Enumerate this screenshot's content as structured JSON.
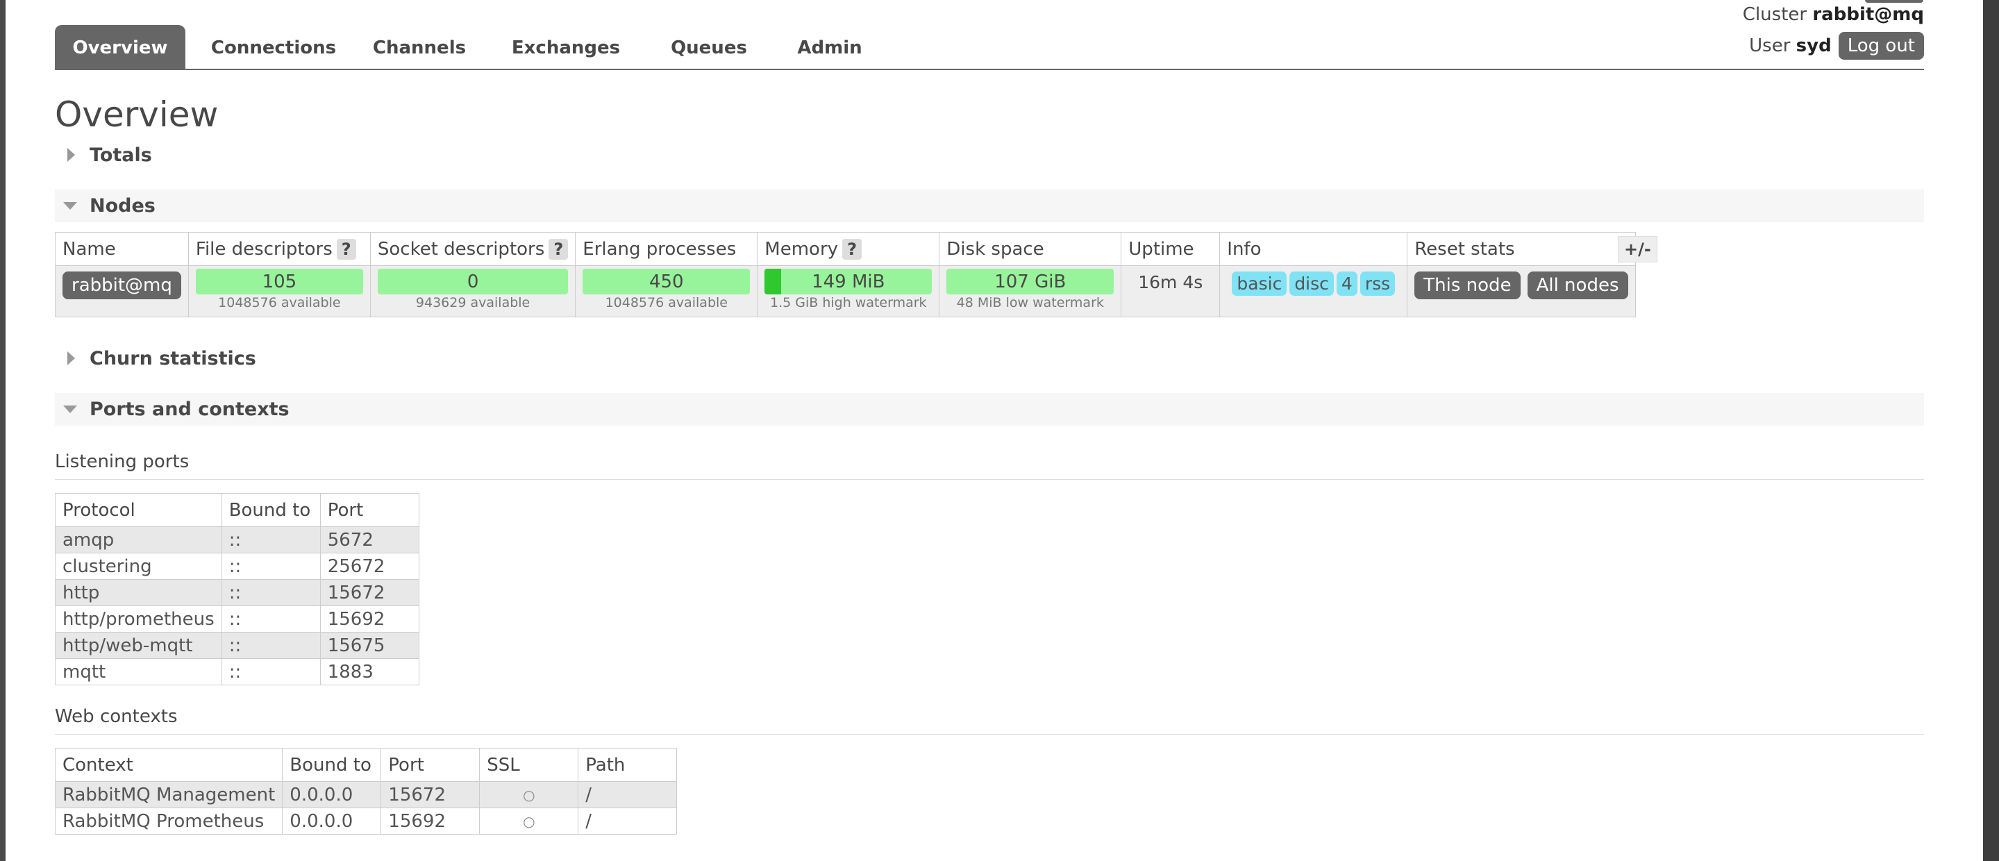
{
  "header": {
    "tabs": [
      "Overview",
      "Connections",
      "Channels",
      "Exchanges",
      "Queues",
      "Admin"
    ],
    "cluster_label": "Cluster",
    "cluster_name": "rabbit@mq",
    "user_label": "User",
    "user_name": "syd",
    "logout": "Log out"
  },
  "page_title": "Overview",
  "sections": {
    "totals": "Totals",
    "nodes": "Nodes",
    "churn": "Churn statistics",
    "ports": "Ports and contexts"
  },
  "nodes_table": {
    "headers": [
      "Name",
      "File descriptors",
      "Socket descriptors",
      "Erlang processes",
      "Memory",
      "Disk space",
      "Uptime",
      "Info",
      "Reset stats"
    ],
    "help": "?",
    "plus_minus": "+/-",
    "row": {
      "name": "rabbit@mq",
      "file_descriptors": {
        "value": "105",
        "sub": "1048576 available"
      },
      "socket_descriptors": {
        "value": "0",
        "sub": "943629 available"
      },
      "erlang_processes": {
        "value": "450",
        "sub": "1048576 available"
      },
      "memory": {
        "value": "149 MiB",
        "sub": "1.5 GiB high watermark",
        "level": 0.1
      },
      "disk_space": {
        "value": "107 GiB",
        "sub": "48 MiB low watermark"
      },
      "uptime": "16m 4s",
      "info_badges": [
        "basic",
        "disc",
        "4",
        "rss"
      ],
      "reset_this": "This node",
      "reset_all": "All nodes"
    }
  },
  "listening_ports": {
    "heading": "Listening ports",
    "headers": [
      "Protocol",
      "Bound to",
      "Port"
    ],
    "rows": [
      [
        "amqp",
        "::",
        "5672"
      ],
      [
        "clustering",
        "::",
        "25672"
      ],
      [
        "http",
        "::",
        "15672"
      ],
      [
        "http/prometheus",
        "::",
        "15692"
      ],
      [
        "http/web-mqtt",
        "::",
        "15675"
      ],
      [
        "mqtt",
        "::",
        "1883"
      ]
    ]
  },
  "web_contexts": {
    "heading": "Web contexts",
    "headers": [
      "Context",
      "Bound to",
      "Port",
      "SSL",
      "Path"
    ],
    "rows": [
      [
        "RabbitMQ Management",
        "0.0.0.0",
        "15672",
        "○",
        "/"
      ],
      [
        "RabbitMQ Prometheus",
        "0.0.0.0",
        "15692",
        "○",
        "/"
      ]
    ]
  },
  "colors": {
    "accent": "#666666",
    "bar_green": "#98f49b",
    "bar_dark_green": "#2fc82f",
    "badge_blue": "#7fe3f5"
  }
}
